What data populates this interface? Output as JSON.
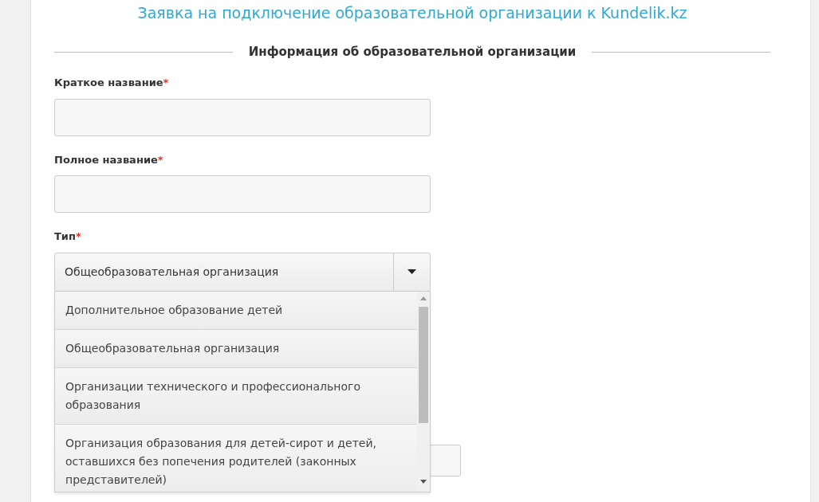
{
  "page_title": "Заявка на подключение образовательной организации к Kundelik.kz",
  "section_heading": "Информация об образовательной организации",
  "fields": [
    {
      "kind": "text",
      "label": "Краткое название",
      "mark": "*"
    },
    {
      "kind": "text",
      "label": "Полное название",
      "mark": "*"
    },
    {
      "kind": "select",
      "label": "Тип",
      "mark": "*",
      "value": "Общеобразовательная организация",
      "expanded": true,
      "options": [
        {
          "label": "Дополнительное образование детей"
        },
        {
          "label": "Общеобразовательная организация"
        },
        {
          "label": "Организации технического и профессионального образования"
        },
        {
          "label": "Организация образования для детей-сирот и детей, оставшихся без попечения родителей (законных представителей)"
        }
      ]
    },
    {
      "kind": "blank"
    }
  ]
}
